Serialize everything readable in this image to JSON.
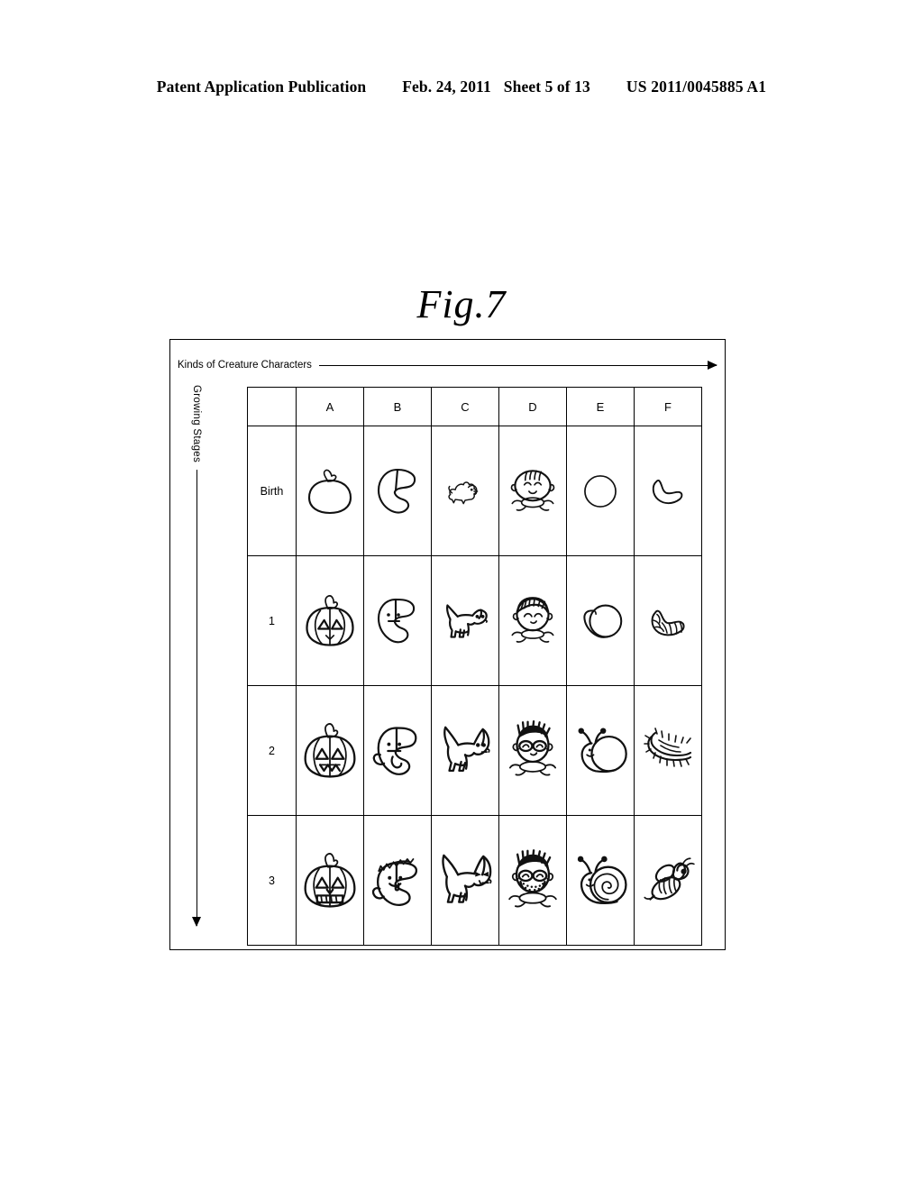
{
  "header": {
    "publication": "Patent Application Publication",
    "date": "Feb. 24, 2011",
    "sheet": "Sheet 5 of 13",
    "number": "US 2011/0045885 A1"
  },
  "figure": {
    "label": "Fig.7",
    "x_axis_caption": "Kinds of Creature Characters",
    "y_axis_caption": "Growing Stages",
    "corner_header": "",
    "column_headers": [
      "A",
      "B",
      "C",
      "D",
      "E",
      "F"
    ],
    "row_headers": [
      "Birth",
      "1",
      "2",
      "3"
    ],
    "cells": [
      {
        "row": "Birth",
        "items": [
          {
            "column": "A",
            "icon": "pumpkin-plain-icon",
            "description": "plain pumpkin outline with stem"
          },
          {
            "column": "B",
            "icon": "ghost-blank-icon",
            "description": "blank teardrop ghost shape, no face"
          },
          {
            "column": "C",
            "icon": "puppy-small-icon",
            "description": "small fluffy puppy"
          },
          {
            "column": "D",
            "icon": "baby-face-icon",
            "description": "baby head with hair strands and closed smiling eyes"
          },
          {
            "column": "E",
            "icon": "snail-egg-icon",
            "description": "plain circle, snail egg/shell"
          },
          {
            "column": "F",
            "icon": "larva-icon",
            "description": "curved smooth larva grub"
          }
        ]
      },
      {
        "row": "1",
        "items": [
          {
            "column": "A",
            "icon": "pumpkin-carved-icon",
            "description": "pumpkin with triangular eyes and small mouth"
          },
          {
            "column": "B",
            "icon": "ghost-face-icon",
            "description": "ghost with two dot eyes and flat line mouth"
          },
          {
            "column": "C",
            "icon": "dog-young-icon",
            "description": "young dog with pointed ears standing"
          },
          {
            "column": "D",
            "icon": "child-face-icon",
            "description": "child head with bowl haircut, smiling"
          },
          {
            "column": "E",
            "icon": "snail-hatching-icon",
            "description": "round shell with body emerging"
          },
          {
            "column": "F",
            "icon": "caterpillar-icon",
            "description": "segmented caterpillar"
          }
        ]
      },
      {
        "row": "2",
        "items": [
          {
            "column": "A",
            "icon": "pumpkin-jack-icon",
            "description": "pumpkin with triangle eyes and jagged mouth"
          },
          {
            "column": "B",
            "icon": "ghost-arm-icon",
            "description": "ghost with arm, flat mouth and dot eyes"
          },
          {
            "column": "C",
            "icon": "dog-grown-icon",
            "description": "grown dog with tall pointed ears"
          },
          {
            "column": "D",
            "icon": "person-glasses-icon",
            "description": "person with spiky hair and glasses"
          },
          {
            "column": "E",
            "icon": "snail-stalks-icon",
            "description": "snail with round shell and eye stalks"
          },
          {
            "column": "F",
            "icon": "centipede-icon",
            "description": "centipede with many legs"
          }
        ]
      },
      {
        "row": "3",
        "items": [
          {
            "column": "A",
            "icon": "pumpkin-toothy-icon",
            "description": "jack-o-lantern with toothy grin"
          },
          {
            "column": "B",
            "icon": "ghost-crown-icon",
            "description": "ghost with spiky crown and fang"
          },
          {
            "column": "C",
            "icon": "dog-fierce-icon",
            "description": "fierce dog with angry eyes"
          },
          {
            "column": "D",
            "icon": "man-beard-icon",
            "description": "bearded man with glasses and spiky hair"
          },
          {
            "column": "E",
            "icon": "snail-spiral-icon",
            "description": "snail with spiral shell and eye stalks"
          },
          {
            "column": "F",
            "icon": "bee-icon",
            "description": "bee with wings and striped body"
          }
        ]
      }
    ]
  },
  "colors": {
    "ink": "#111111",
    "page": "#ffffff"
  }
}
